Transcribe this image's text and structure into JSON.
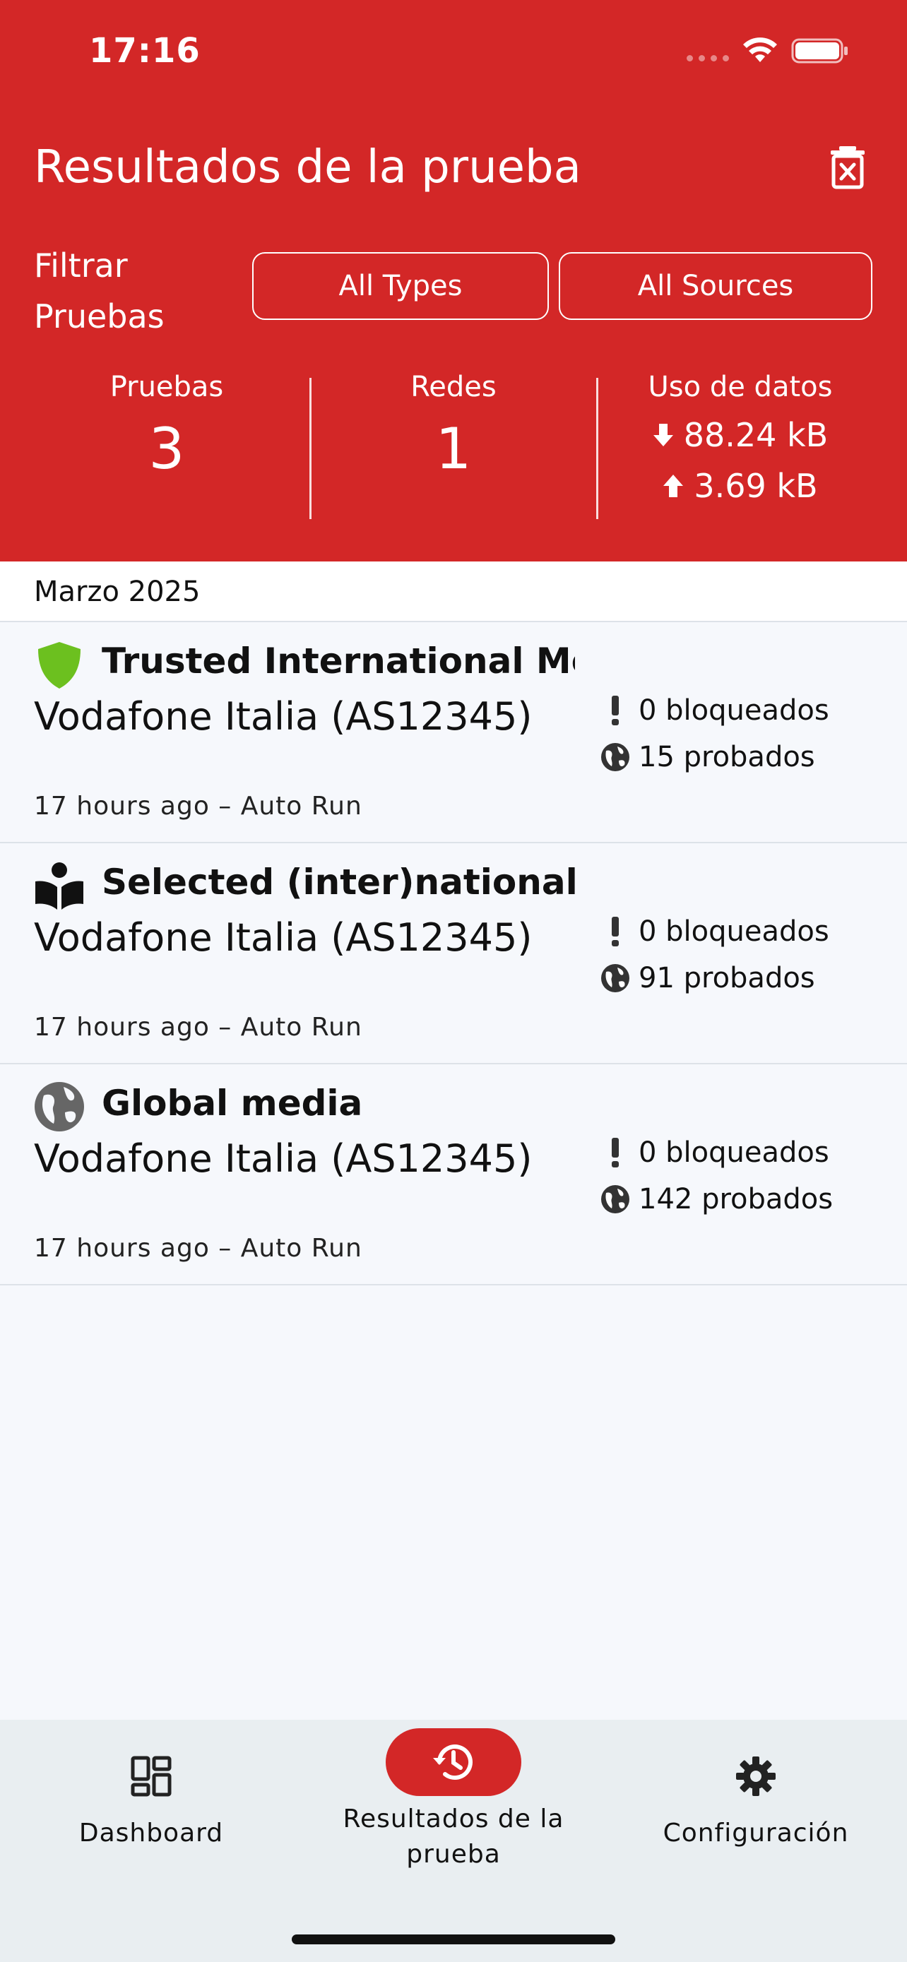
{
  "status_bar": {
    "time": "17:16"
  },
  "header": {
    "title": "Resultados de la prueba",
    "filter_label": "Filtrar Pruebas",
    "filter_types": "All Types",
    "filter_sources": "All Sources"
  },
  "stats": {
    "tests_label": "Pruebas",
    "tests_value": "3",
    "networks_label": "Redes",
    "networks_value": "1",
    "data_label": "Uso de datos",
    "download": "88.24 kB",
    "upload": "3.69 kB"
  },
  "list": {
    "month": "Marzo 2025",
    "rows": [
      {
        "title": "Trusted International Me...",
        "network": "Vodafone Italia (AS12345)",
        "time": "17 hours ago – Auto Run",
        "blocked": "0 bloqueados",
        "tested": "15 probados",
        "icon": "shield-icon"
      },
      {
        "title": "Selected (inter)national ...",
        "network": "Vodafone Italia (AS12345)",
        "time": "17 hours ago – Auto Run",
        "blocked": "0 bloqueados",
        "tested": "91 probados",
        "icon": "book-reader-icon"
      },
      {
        "title": "Global media",
        "network": "Vodafone Italia (AS12345)",
        "time": "17 hours ago – Auto Run",
        "blocked": "0 bloqueados",
        "tested": "142 probados",
        "icon": "globe-icon"
      }
    ]
  },
  "tabbar": {
    "dashboard": "Dashboard",
    "results": "Resultados de la prueba",
    "settings": "Configuración"
  },
  "colors": {
    "brand": "#d32727",
    "shield": "#6cc01f",
    "background": "#f6f8fc",
    "tabbar": "#e9eef1"
  }
}
